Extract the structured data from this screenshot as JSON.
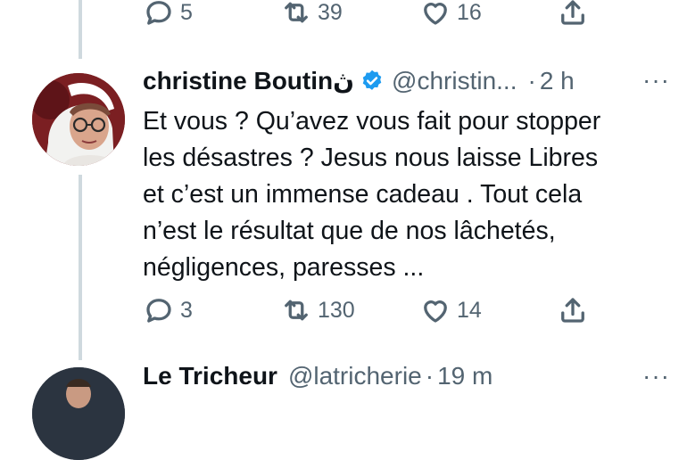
{
  "top_tweet": {
    "actions": {
      "reply_count": "5",
      "retweet_count": "39",
      "like_count": "16"
    }
  },
  "main_tweet": {
    "author_name": "christine Boutinڽ",
    "handle": "@christin...",
    "dot": "·",
    "time": "2 h",
    "more": "···",
    "text_lines": [
      "Et vous ? Qu’avez vous fait pour stopper",
      "les désastres ? Jesus nous laisse Libres",
      "et c’est un immense cadeau . Tout cela",
      "n’est le résultat que de nos lâchetés,",
      "négligences, paresses ..."
    ],
    "actions": {
      "reply_count": "3",
      "retweet_count": "130",
      "like_count": "14"
    }
  },
  "next_tweet": {
    "author_name": "Le Tricheur",
    "handle": "@latricherie",
    "dot": "·",
    "time": "19 m",
    "more": "···"
  },
  "colors": {
    "verified": "#1d9bf0",
    "secondary_text": "#536471",
    "thread_line": "#cfd9de"
  },
  "icons": [
    "reply-icon",
    "retweet-icon",
    "like-icon",
    "share-icon",
    "verified-icon",
    "more-icon"
  ]
}
